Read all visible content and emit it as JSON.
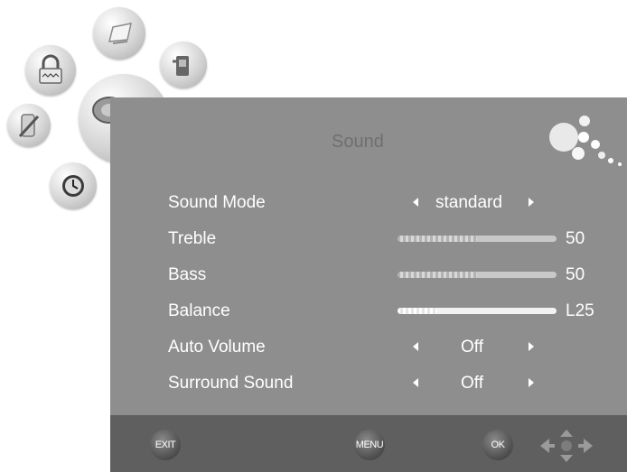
{
  "menu": {
    "title": "Sound",
    "items": [
      {
        "label": "Sound Mode",
        "type": "select",
        "value": "standard"
      },
      {
        "label": "Treble",
        "type": "slider",
        "value": "50",
        "level": 0.5
      },
      {
        "label": "Bass",
        "type": "slider",
        "value": "50",
        "level": 0.5
      },
      {
        "label": "Balance",
        "type": "slider",
        "value": "L25",
        "level": 0.25
      },
      {
        "label": "Auto Volume",
        "type": "select",
        "value": "Off"
      },
      {
        "label": "Surround Sound",
        "type": "select",
        "value": "Off"
      }
    ]
  },
  "footer": {
    "exit_label": "EXIT",
    "menu_label": "MENU",
    "ok_label": "OK"
  },
  "icons": [
    "picture-icon",
    "lock-icon",
    "channel-icon",
    "sound-icon",
    "setup-icon",
    "timer-icon",
    "dpad-icon"
  ],
  "colors": {
    "panel": "#8e8e8e",
    "footer": "#5f5f5f",
    "text": "#ffffff",
    "title": "#6f6f6f"
  }
}
